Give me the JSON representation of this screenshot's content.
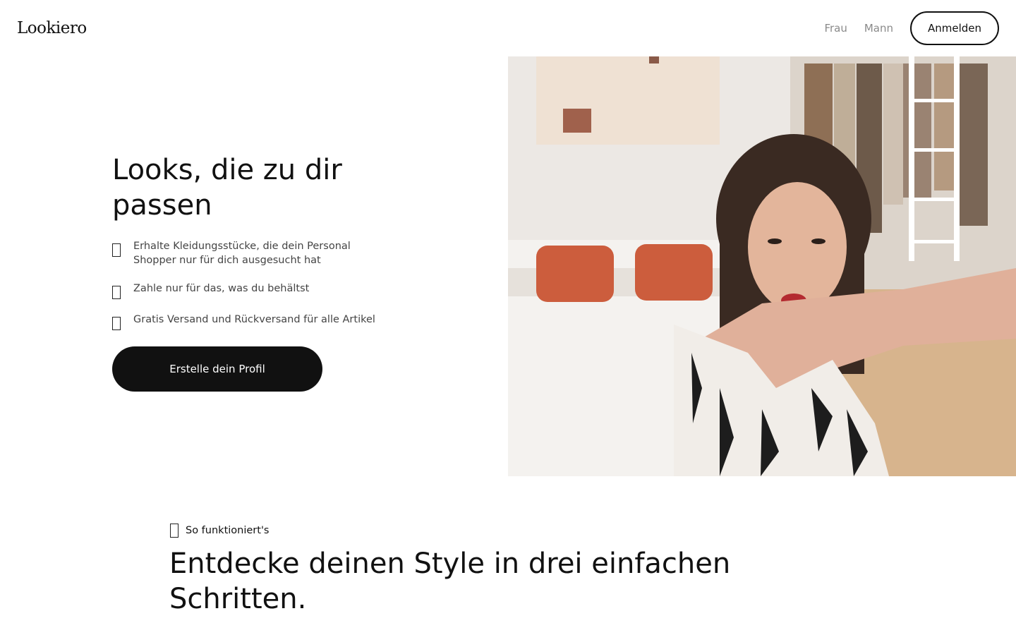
{
  "header": {
    "logo": "Lookiero",
    "nav": [
      {
        "label": "Frau"
      },
      {
        "label": "Mann"
      }
    ],
    "login_label": "Anmelden"
  },
  "hero": {
    "title": "Looks, die zu dir passen",
    "benefits": [
      {
        "text": "Erhalte Kleidungsstücke, die dein Personal Shopper nur für dich ausgesucht hat",
        "icon": "check-icon"
      },
      {
        "text": "Zahle nur für das, was du behältst",
        "icon": "check-icon"
      },
      {
        "text": "Gratis Versand und Rückversand für alle Artikel",
        "icon": "check-icon"
      }
    ],
    "cta_label": "Erstelle dein Profil",
    "image": {
      "subject": "woman-in-bedroom-photo"
    }
  },
  "how_it_works": {
    "label": "So funktioniert's",
    "title": "Entdecke deinen Style in drei einfachen Schritten."
  },
  "colors": {
    "text": "#111111",
    "muted": "#8a8a8a",
    "cta_bg": "#111111",
    "cta_text": "#ffffff",
    "background": "#ffffff"
  }
}
